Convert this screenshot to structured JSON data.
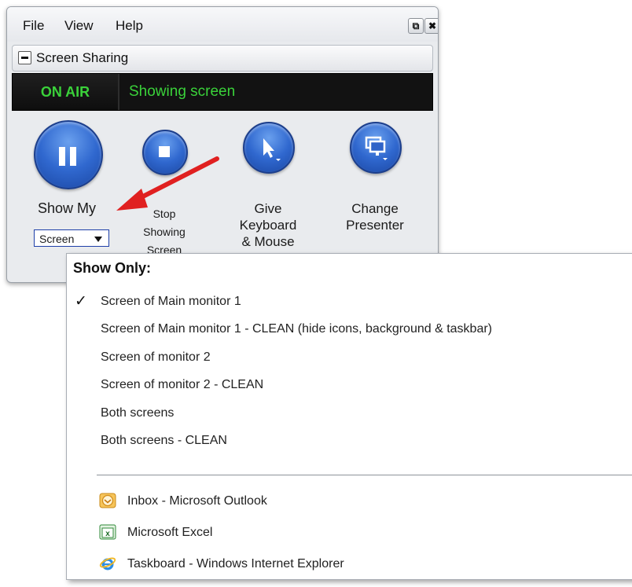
{
  "menubar": {
    "file": "File",
    "view": "View",
    "help": "Help",
    "restore_glyph": "⧉",
    "close_glyph": "✖"
  },
  "section": {
    "title": "Screen Sharing"
  },
  "status": {
    "badge": "ON AIR",
    "text": "Showing screen",
    "color": "#3ad23a"
  },
  "controls": {
    "show_my": {
      "label": "Show My",
      "dropdown": "Screen"
    },
    "stop": {
      "line1": "Stop",
      "line2": "Showing",
      "line3": "Screen"
    },
    "give": {
      "line1": "Give",
      "line2": "Keyboard",
      "line3": "& Mouse"
    },
    "change": {
      "line1": "Change",
      "line2": "Presenter"
    }
  },
  "menu": {
    "title": "Show Only:",
    "check": "✓",
    "items": [
      {
        "label": "Screen of Main monitor 1",
        "checked": true
      },
      {
        "label": "Screen of Main monitor 1 - CLEAN (hide icons, background & taskbar)",
        "checked": false
      },
      {
        "label": "Screen of monitor 2",
        "checked": false
      },
      {
        "label": "Screen of monitor 2 - CLEAN",
        "checked": false
      },
      {
        "label": "Both screens",
        "checked": false
      },
      {
        "label": "Both screens - CLEAN",
        "checked": false
      }
    ],
    "apps": [
      {
        "label": "Inbox - Microsoft Outlook",
        "icon": "outlook-icon"
      },
      {
        "label": "Microsoft Excel",
        "icon": "excel-icon"
      },
      {
        "label": "Taskboard - Windows Internet Explorer",
        "icon": "internet-explorer-icon"
      }
    ]
  },
  "colors": {
    "button_blue": "#3068cf",
    "arrow_red": "#e02020"
  }
}
